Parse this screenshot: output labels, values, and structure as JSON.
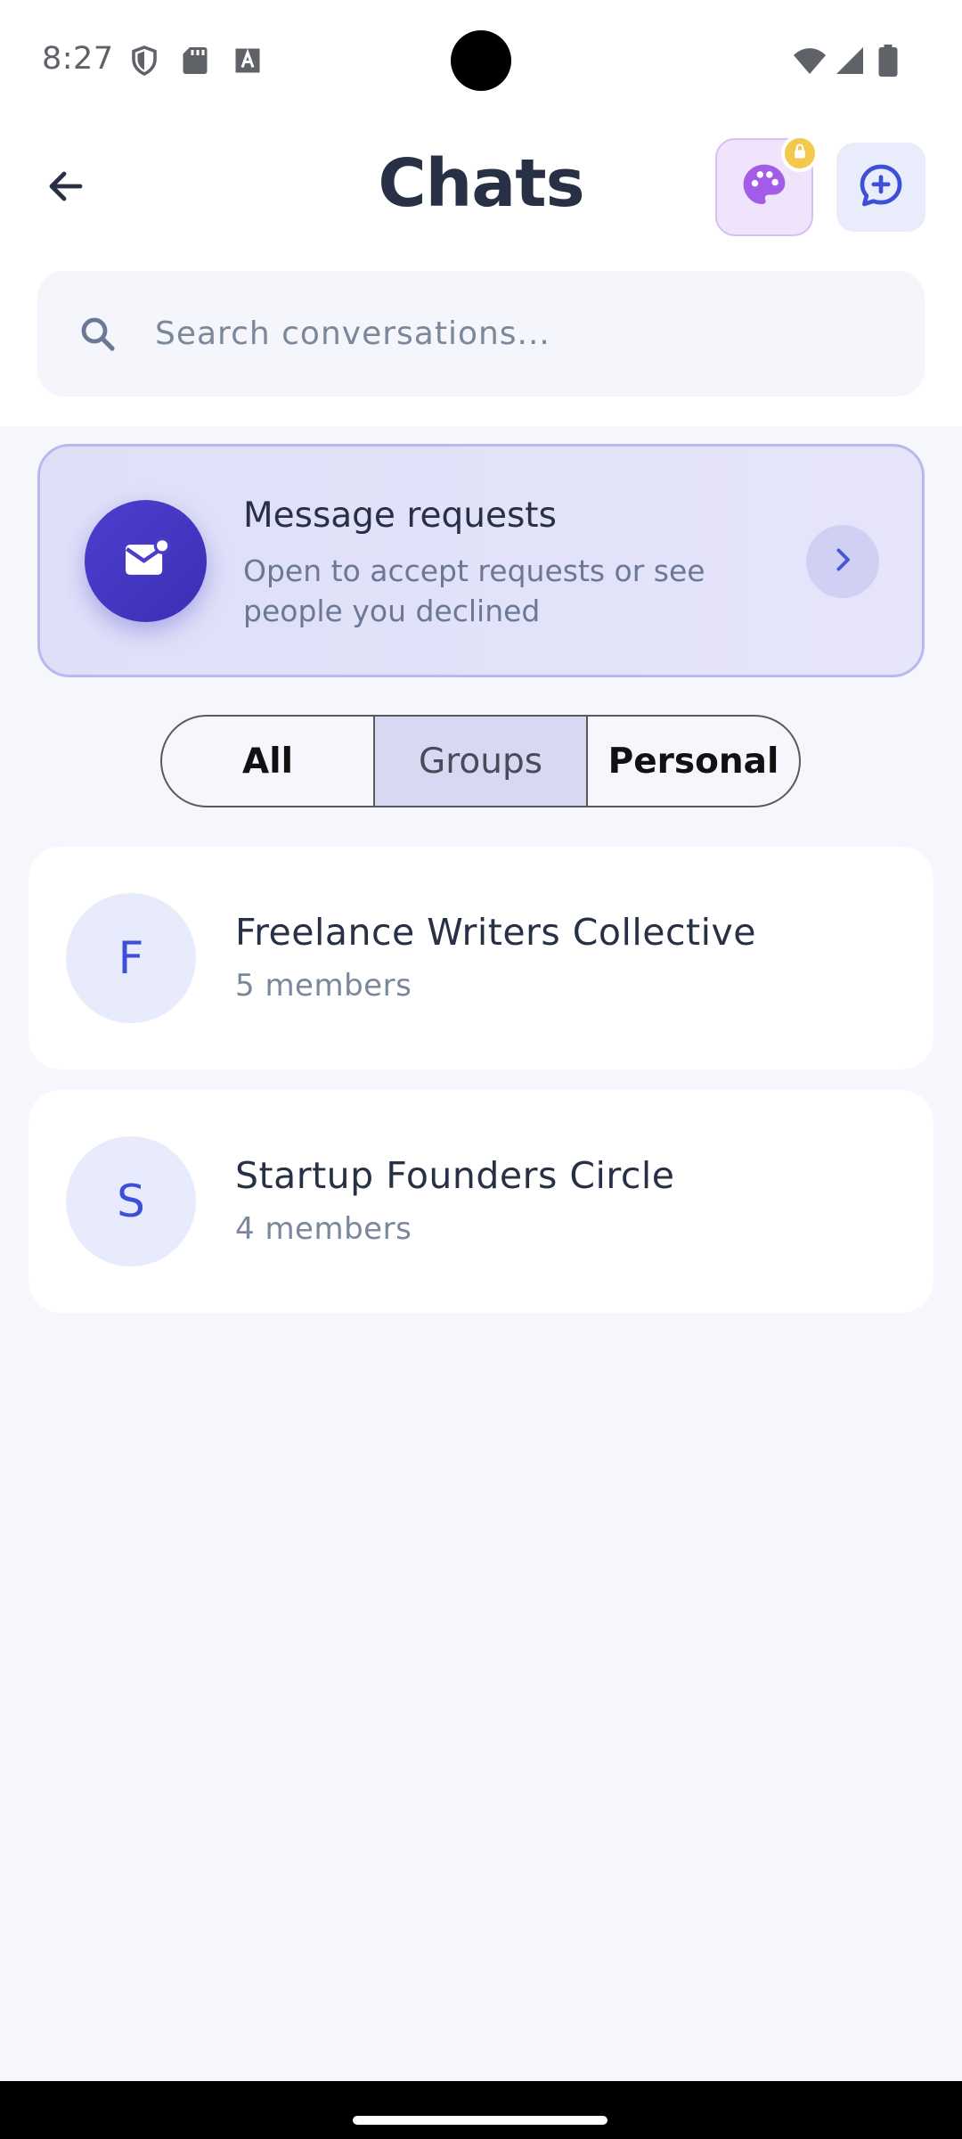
{
  "status_bar": {
    "time": "8:27",
    "icons_left": [
      "shield-icon",
      "sd-card-icon",
      "font-icon"
    ],
    "icons_right": [
      "wifi-icon",
      "signal-icon",
      "battery-icon"
    ]
  },
  "header": {
    "title": "Chats",
    "back_icon": "arrow-left-icon",
    "theme_icon": "palette-icon",
    "theme_locked": true,
    "new_chat_icon": "message-plus-icon"
  },
  "search": {
    "placeholder": "Search conversations..."
  },
  "requests": {
    "title": "Message requests",
    "subtitle": "Open to accept requests or see people you declined",
    "icon": "envelope-icon"
  },
  "filters": {
    "tabs": [
      {
        "label": "All",
        "active": false
      },
      {
        "label": "Groups",
        "active": true
      },
      {
        "label": "Personal",
        "active": false
      }
    ]
  },
  "groups": [
    {
      "initial": "F",
      "name": "Freelance Writers Collective",
      "members": "5 members"
    },
    {
      "initial": "S",
      "name": "Startup Founders Circle",
      "members": "4 members"
    }
  ],
  "colors": {
    "accent": "#4f46e5",
    "background": "#f5f7fd",
    "title": "#283045",
    "muted": "#7a879c"
  }
}
